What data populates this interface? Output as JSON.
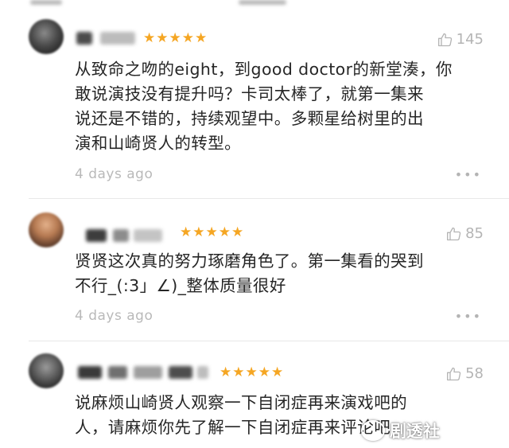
{
  "comments": [
    {
      "stars": "★★★★★",
      "likes": "145",
      "text": "从致命之吻的eight，到good doctor的新堂湊，你\n敢说演技没有提升吗？卡司太棒了，就第一集来\n说还是不错的，持续观望中。多颗星给树里的出\n演和山崎贤人的转型。",
      "time": "4 days ago",
      "more": "•••"
    },
    {
      "stars": "★★★★★",
      "likes": "85",
      "text": "贤贤这次真的努力琢磨角色了。第一集看的哭到\n不行_(:3」∠)_整体质量很好",
      "time": "4 days ago",
      "more": "•••"
    },
    {
      "stars": "★★★★★",
      "likes": "58",
      "text": "说麻烦山崎贤人观察一下自闭症再来演戏吧的\n人，请麻烦你先了解一下自闭症再来评论吧",
      "time": "",
      "more": ""
    }
  ],
  "watermark": "剧透社",
  "colors": {
    "star": "#f5a623",
    "meta": "#b4b4b4",
    "text": "#262626"
  },
  "icons": {
    "like": "thumbs-up-icon",
    "more": "more-dots-icon"
  }
}
